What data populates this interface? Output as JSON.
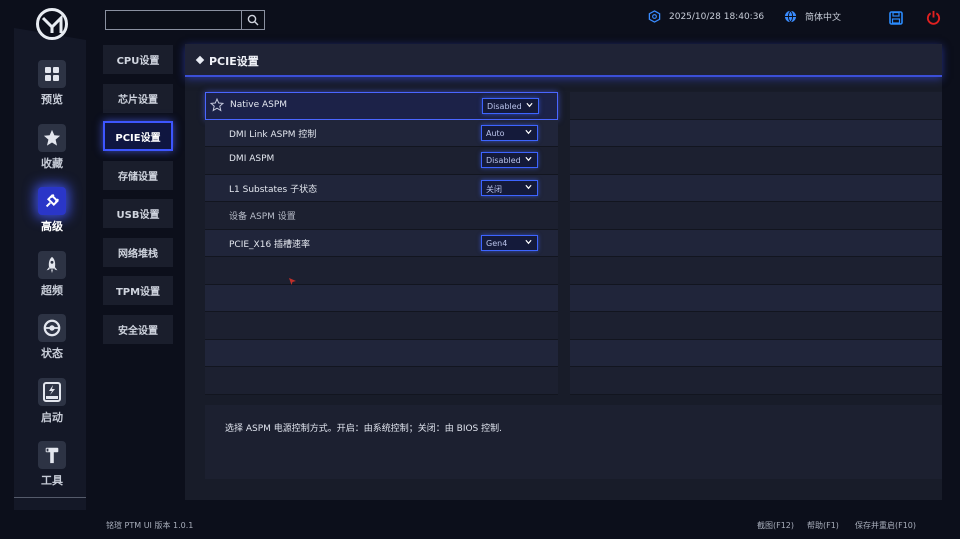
{
  "rail": {
    "items": [
      {
        "label": "预览",
        "icon": "grid-icon"
      },
      {
        "label": "收藏",
        "icon": "star-icon"
      },
      {
        "label": "高级",
        "icon": "plug-icon"
      },
      {
        "label": "超频",
        "icon": "rocket-icon"
      },
      {
        "label": "状态",
        "icon": "gauge-icon"
      },
      {
        "label": "启动",
        "icon": "ssd-icon"
      },
      {
        "label": "工具",
        "icon": "wrench-icon"
      }
    ]
  },
  "topbar": {
    "search_placeholder": "",
    "datetime": "2025/10/28 18:40:36",
    "language": "简体中文"
  },
  "submenu": {
    "items": [
      "CPU设置",
      "芯片设置",
      "PCIE设置",
      "存储设置",
      "USB设置",
      "网络堆栈",
      "TPM设置",
      "安全设置"
    ]
  },
  "panel": {
    "title": "PCIE设置"
  },
  "settings": [
    {
      "label": "Native ASPM",
      "value": "Disabled"
    },
    {
      "label": "DMI Link ASPM 控制",
      "value": "Auto"
    },
    {
      "label": "DMI ASPM",
      "value": "Disabled"
    },
    {
      "label": "L1 Substates 子状态",
      "value": "关闭"
    },
    {
      "label": "设备 ASPM 设置",
      "value": ""
    },
    {
      "label": "PCIE_X16 插槽速率",
      "value": "Gen4"
    }
  ],
  "description": "选择 ASPM 电源控制方式。开启：由系统控制；关闭：由 BIOS 控制.",
  "footer": {
    "version": "铭瑄 PTM UI 版本 1.0.1",
    "screenshot": "截图(F12)",
    "help": "帮助(F1)",
    "save_reboot": "保存并重启(F10)"
  },
  "colors": {
    "accent": "#3d56ff",
    "background": "#0c0f1b",
    "power": "#e02020",
    "save": "#2a8cff"
  }
}
